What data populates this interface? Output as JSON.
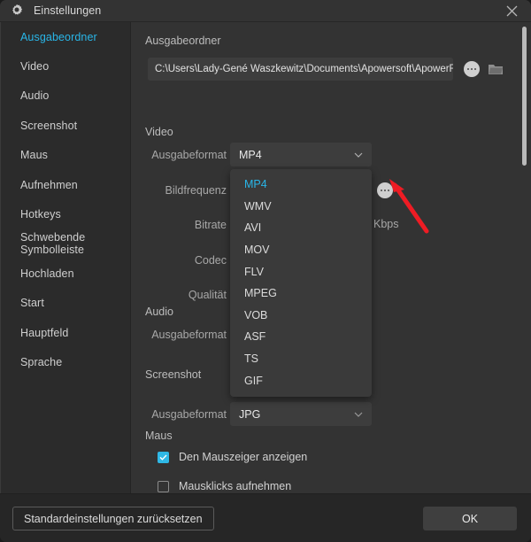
{
  "window": {
    "title": "Einstellungen",
    "gear_icon": "gear-icon",
    "close_icon": "close-icon"
  },
  "colors": {
    "accent": "#29b6e8",
    "checkbox_on": "#2fb8e6",
    "annotation_arrow": "#ee1c24",
    "window_bg": "#2c2c2c",
    "sidebar_bg": "#2b2b2b",
    "content_bg": "#333333",
    "field_bg": "#3d3d3d",
    "dropdown_bg": "#3a3a3a",
    "footer_bg": "#262626"
  },
  "sidebar": {
    "items": [
      {
        "label": "Ausgabeordner",
        "active": true
      },
      {
        "label": "Video",
        "active": false
      },
      {
        "label": "Audio",
        "active": false
      },
      {
        "label": "Screenshot",
        "active": false
      },
      {
        "label": "Maus",
        "active": false
      },
      {
        "label": "Aufnehmen",
        "active": false
      },
      {
        "label": "Hotkeys",
        "active": false
      },
      {
        "label": "Schwebende Symbolleiste",
        "active": false
      },
      {
        "label": "Hochladen",
        "active": false
      },
      {
        "label": "Start",
        "active": false
      },
      {
        "label": "Hauptfeld",
        "active": false
      },
      {
        "label": "Sprache",
        "active": false
      }
    ]
  },
  "content": {
    "output_folder": {
      "group_title": "Ausgabeordner",
      "path_value": "C:\\Users\\Lady-Gené Waszkewitz\\Documents\\Apowersoft\\ApowerREC",
      "browse_dots_icon": "ellipsis-icon",
      "folder_icon": "folder-icon"
    },
    "video": {
      "group_title": "Video",
      "format_label": "Ausgabeformat",
      "format_value": "MP4",
      "framerate_label": "Bildfrequenz",
      "bitrate_label": "Bitrate",
      "bitrate_unit": "Kbps",
      "codec_label": "Codec",
      "quality_label": "Qualität",
      "more_dots_icon": "ellipsis-icon"
    },
    "audio": {
      "group_title": "Audio",
      "format_label": "Ausgabeformat"
    },
    "screenshot": {
      "group_title": "Screenshot",
      "format_label": "Ausgabeformat",
      "format_value": "JPG"
    },
    "mouse": {
      "group_title": "Maus",
      "show_cursor_label": "Den Mauszeiger anzeigen",
      "show_cursor_checked": true,
      "record_clicks_label": "Mausklicks aufnehmen",
      "record_clicks_checked": false
    }
  },
  "video_format_dropdown": {
    "open": true,
    "selected": "MP4",
    "options": [
      "MP4",
      "WMV",
      "AVI",
      "MOV",
      "FLV",
      "MPEG",
      "VOB",
      "ASF",
      "TS",
      "GIF"
    ]
  },
  "annotation": {
    "arrow_icon": "red-arrow-icon",
    "points_to": "MP4"
  },
  "footer": {
    "reset_label": "Standardeinstellungen zurücksetzen",
    "ok_label": "OK"
  }
}
